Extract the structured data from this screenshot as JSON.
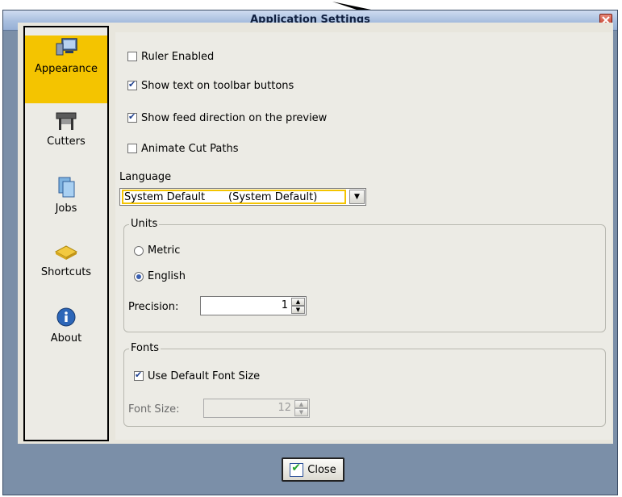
{
  "window": {
    "title": "Application Settings"
  },
  "sidebar": {
    "items": [
      {
        "label": "Appearance",
        "icon": "monitor-icon",
        "selected": true
      },
      {
        "label": "Cutters",
        "icon": "plotter-icon",
        "selected": false
      },
      {
        "label": "Jobs",
        "icon": "documents-icon",
        "selected": false
      },
      {
        "label": "Shortcuts",
        "icon": "keyboard-icon",
        "selected": false
      },
      {
        "label": "About",
        "icon": "info-icon",
        "selected": false
      }
    ]
  },
  "appearance": {
    "ruler_enabled": {
      "label": "Ruler Enabled",
      "checked": false
    },
    "show_toolbar_text": {
      "label": "Show text on toolbar buttons",
      "checked": true
    },
    "show_feed_direction": {
      "label": "Show feed direction on the preview",
      "checked": true
    },
    "animate_cut_paths": {
      "label": "Animate Cut Paths",
      "checked": false
    },
    "language": {
      "label": "Language",
      "value": "System Default       (System Default)"
    },
    "units": {
      "legend": "Units",
      "metric": {
        "label": "Metric",
        "selected": false
      },
      "english": {
        "label": "English",
        "selected": true
      },
      "precision_label": "Precision:",
      "precision_value": "1"
    },
    "fonts": {
      "legend": "Fonts",
      "use_default": {
        "label": "Use Default Font Size",
        "checked": true
      },
      "font_size_label": "Font Size:",
      "font_size_value": "12"
    }
  },
  "footer": {
    "close_label": "Close"
  },
  "colors": {
    "selection": "#f4c400",
    "frame": "#7b8fa8",
    "panel": "#ecebe5"
  }
}
